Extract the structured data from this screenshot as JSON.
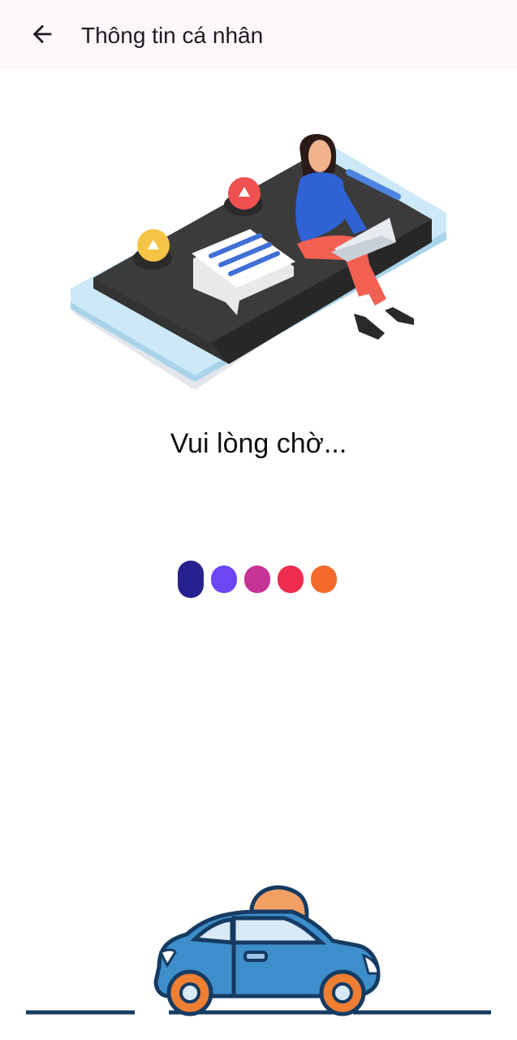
{
  "header": {
    "back_icon": "arrow-left-icon",
    "title": "Thông tin cá nhân"
  },
  "illustration": {
    "icon": "person-sitting-on-phone-illustration"
  },
  "status": {
    "message": "Vui lòng chờ..."
  },
  "loader": {
    "dot_colors": [
      "#25218f",
      "#6c47f5",
      "#c63396",
      "#ef2d4f",
      "#f46a2a"
    ]
  },
  "footer_art": {
    "icon": "car-on-road-illustration"
  }
}
